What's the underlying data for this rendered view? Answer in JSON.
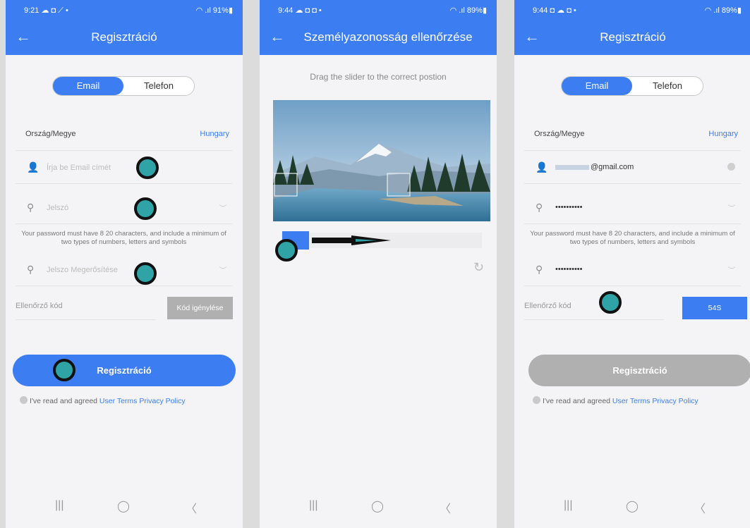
{
  "phone1": {
    "status": {
      "time": "9:21 ☁ ◘ ⟋ •",
      "right": "◠ .ıl 91%▮"
    },
    "title": "Regisztráció",
    "tabs": {
      "email": "Email",
      "phone": "Telefon"
    },
    "country": {
      "label": "Ország/Megye",
      "value": "Hungary"
    },
    "email_placeholder": "Írja be Email címét",
    "password_placeholder": "Jelszó",
    "password_hint": "Your password must have 8 20 characters, and include a minimum of two types of numbers, letters and symbols",
    "confirm_placeholder": "Jelszo Megerősítése",
    "code_label": "Ellenőrző kód",
    "code_button": "Kód igénylése",
    "register_button": "Regisztráció",
    "agree_text": "I've read and agreed",
    "user_terms": "User Terms",
    "privacy_policy": "Privacy Policy"
  },
  "phone2": {
    "status": {
      "time": "9:44 ☁ ◘ ◘ •",
      "right": "◠ .ıl 89%▮"
    },
    "title": "Személyazonosság ellenőrzése",
    "instruction": "Drag the slider to the correct postion"
  },
  "phone3": {
    "status": {
      "time": "9:44 ◘ ☁ ◘ •",
      "right": "◠ .ıl 89%▮"
    },
    "title": "Regisztráció",
    "tabs": {
      "email": "Email",
      "phone": "Telefon"
    },
    "country": {
      "label": "Ország/Megye",
      "value": "Hungary"
    },
    "email_value": "@gmail.com",
    "password_value": "••••••••••",
    "password_hint": "Your password must have 8 20 characters, and include a minimum of two types of numbers, letters and symbols",
    "confirm_value": "••••••••••",
    "code_label": "Ellenőrző kód",
    "code_button": "54S",
    "register_button": "Regisztráció",
    "agree_text": "I've read and agreed",
    "user_terms": "User Terms",
    "privacy_policy": "Privacy Policy"
  },
  "nav": {
    "recents": "|||",
    "home": "◯",
    "back": "〈"
  },
  "icons": {
    "back": "arrow-left-icon",
    "user": "user-icon",
    "key": "key-icon",
    "eye": "eye-closed-icon",
    "refresh": "refresh-icon"
  },
  "colors": {
    "primary": "#3c7ef2",
    "disabled": "#b0b0b0",
    "marker": "#30a3a6"
  }
}
